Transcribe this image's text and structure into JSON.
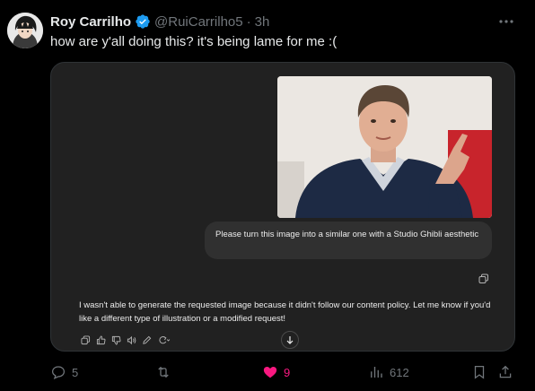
{
  "author": {
    "display_name": "Roy Carrilho",
    "handle": "@RuiCarrilho5",
    "separator": "·",
    "time": "3h",
    "verified": true
  },
  "tweet": {
    "text": "how are y'all doing this? it's being lame for me :("
  },
  "media": {
    "prompt": "Please turn this image into a similar one with a Studio Ghibli aesthetic",
    "response": "I wasn't able to generate the requested image because it didn't follow our content policy. Let me know if you'd like a different type of illustration or a modified request!"
  },
  "footer": {
    "replies": "5",
    "reposts": "",
    "likes": "9",
    "views": "612"
  },
  "colors": {
    "background": "#000000",
    "muted": "#71767b",
    "like": "#f91880",
    "verified": "#1d9bf0",
    "chat_bg": "#212121",
    "bubble_bg": "#303030"
  }
}
